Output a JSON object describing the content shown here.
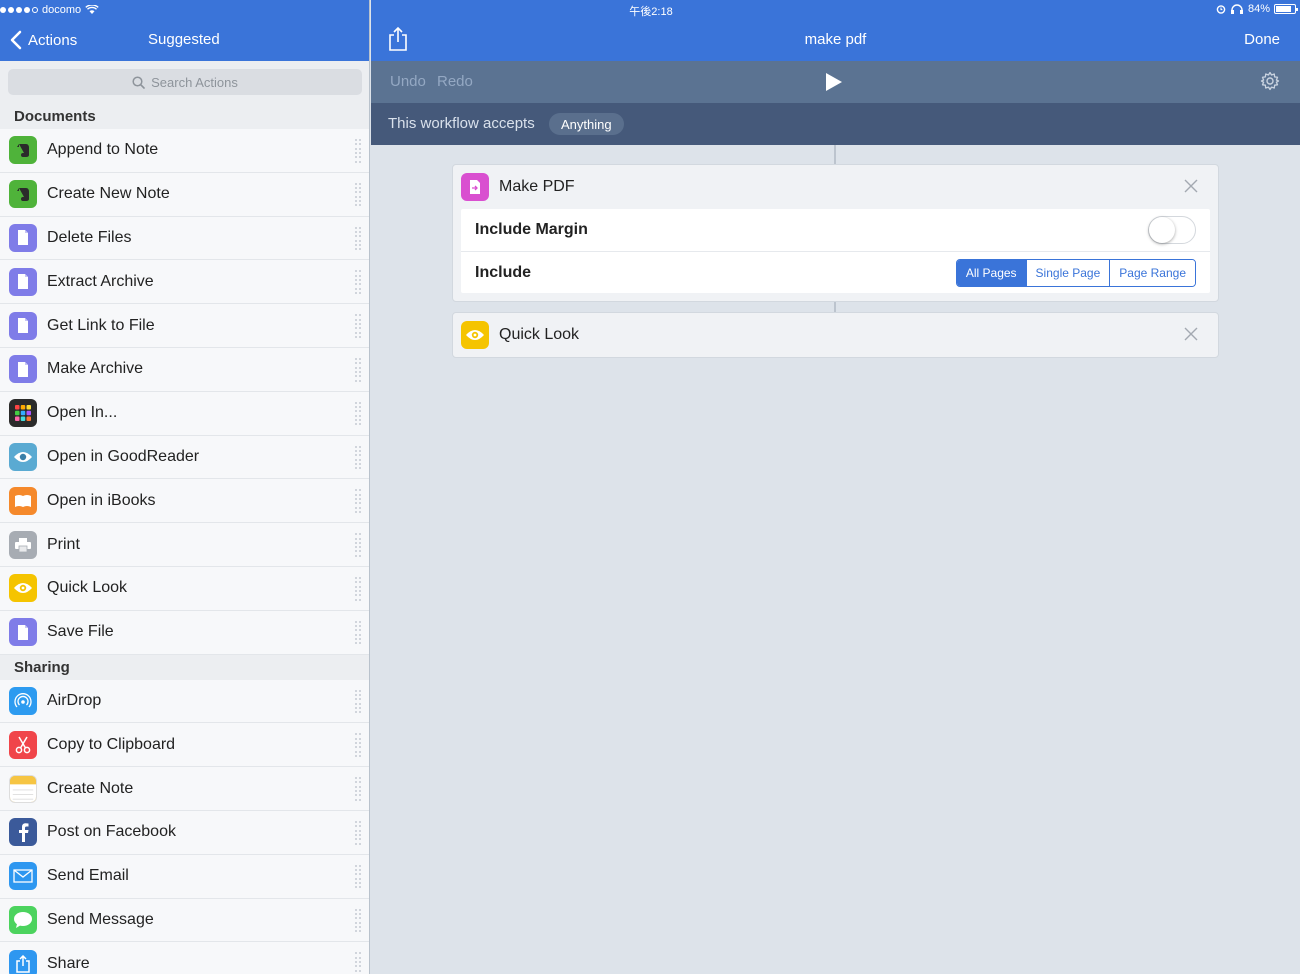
{
  "status": {
    "carrier": "docomo",
    "time": "午後2:18",
    "battery": "84%",
    "battery_level": 0.84
  },
  "left_nav": {
    "back_label": "Actions",
    "suggested_label": "Suggested",
    "search_placeholder": "Search Actions"
  },
  "sections": [
    {
      "title": "Documents",
      "items": [
        {
          "label": "Append to Note",
          "icon": "evernote-icon",
          "color": "#4fb33a"
        },
        {
          "label": "Create New Note",
          "icon": "evernote-icon",
          "color": "#4fb33a"
        },
        {
          "label": "Delete Files",
          "icon": "file-icon",
          "color": "#7f7ce8"
        },
        {
          "label": "Extract Archive",
          "icon": "file-icon",
          "color": "#7f7ce8"
        },
        {
          "label": "Get Link to File",
          "icon": "file-icon",
          "color": "#7f7ce8"
        },
        {
          "label": "Make Archive",
          "icon": "file-icon",
          "color": "#7f7ce8"
        },
        {
          "label": "Open In...",
          "icon": "apps-grid-icon",
          "color": "#2b2b2b"
        },
        {
          "label": "Open in GoodReader",
          "icon": "goodreader-eye-icon",
          "color": "#5aaad2"
        },
        {
          "label": "Open in iBooks",
          "icon": "ibooks-icon",
          "color": "#f5892b"
        },
        {
          "label": "Print",
          "icon": "printer-icon",
          "color": "#a7acb3"
        },
        {
          "label": "Quick Look",
          "icon": "eye-icon",
          "color": "#f5c400"
        },
        {
          "label": "Save File",
          "icon": "file-icon",
          "color": "#7f7ce8"
        }
      ]
    },
    {
      "title": "Sharing",
      "items": [
        {
          "label": "AirDrop",
          "icon": "airdrop-icon",
          "color": "#2d9bf0"
        },
        {
          "label": "Copy to Clipboard",
          "icon": "scissors-icon",
          "color": "#f0454a"
        },
        {
          "label": "Create Note",
          "icon": "notes-icon",
          "color": "#f6c543"
        },
        {
          "label": "Post on Facebook",
          "icon": "facebook-icon",
          "color": "#3b5a9a"
        },
        {
          "label": "Send Email",
          "icon": "mail-icon",
          "color": "#2e97f0"
        },
        {
          "label": "Send Message",
          "icon": "message-icon",
          "color": "#4cd35e"
        },
        {
          "label": "Share",
          "icon": "share-icon",
          "color": "#2e97f0"
        }
      ]
    }
  ],
  "workflow": {
    "title": "make pdf",
    "done_label": "Done",
    "undo_label": "Undo",
    "redo_label": "Redo",
    "accepts_label": "This workflow accepts",
    "accepts_value": "Anything"
  },
  "actions": {
    "make_pdf": {
      "title": "Make PDF",
      "icon": "pdf-icon",
      "color": "#d94fd0",
      "include_margin_label": "Include Margin",
      "include_margin_on": false,
      "include_label": "Include",
      "include_options": [
        "All Pages",
        "Single Page",
        "Page Range"
      ],
      "include_selected": "All Pages"
    },
    "quick_look": {
      "title": "Quick Look",
      "icon": "eye-icon",
      "color": "#f5c400"
    }
  },
  "colors": {
    "accent": "#3a74d9",
    "toolbar": "#5b7392",
    "accepts_bar": "#45597a"
  }
}
